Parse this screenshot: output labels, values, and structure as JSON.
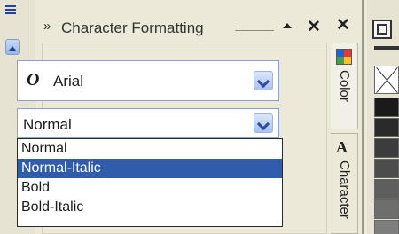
{
  "docker": {
    "title": "Character Formatting",
    "title_grip": "»",
    "close_glyph": "✕"
  },
  "font": {
    "icon_glyph": "O",
    "value": "Arial"
  },
  "style": {
    "value": "Normal",
    "options": [
      "Normal",
      "Normal-Italic",
      "Bold",
      "Bold-Italic"
    ],
    "selected_index": 1
  },
  "tabs": [
    {
      "label": "Color",
      "icon": "color-swatch-icon"
    },
    {
      "label": "Character",
      "icon": "character-glyph-icon"
    }
  ],
  "right_bar": {
    "close_glyph": "✕"
  },
  "palette": {
    "swatches": [
      {
        "name": "none",
        "color": "#ffffff"
      },
      {
        "name": "black",
        "color": "#1a1a1a"
      },
      {
        "name": "gray-90",
        "color": "#2a2a2a"
      },
      {
        "name": "gray-80",
        "color": "#3c3c3c"
      },
      {
        "name": "gray-70",
        "color": "#4c4c4c"
      },
      {
        "name": "gray-60",
        "color": "#5e5e5e"
      },
      {
        "name": "gray-50",
        "color": "#6e6e6e"
      },
      {
        "name": "gray-40",
        "color": "#7e7e7e"
      }
    ]
  },
  "colors": {
    "selection": "#2f5dab",
    "accent": "#8aa3cc",
    "panel_bg": "#ece9d8"
  }
}
